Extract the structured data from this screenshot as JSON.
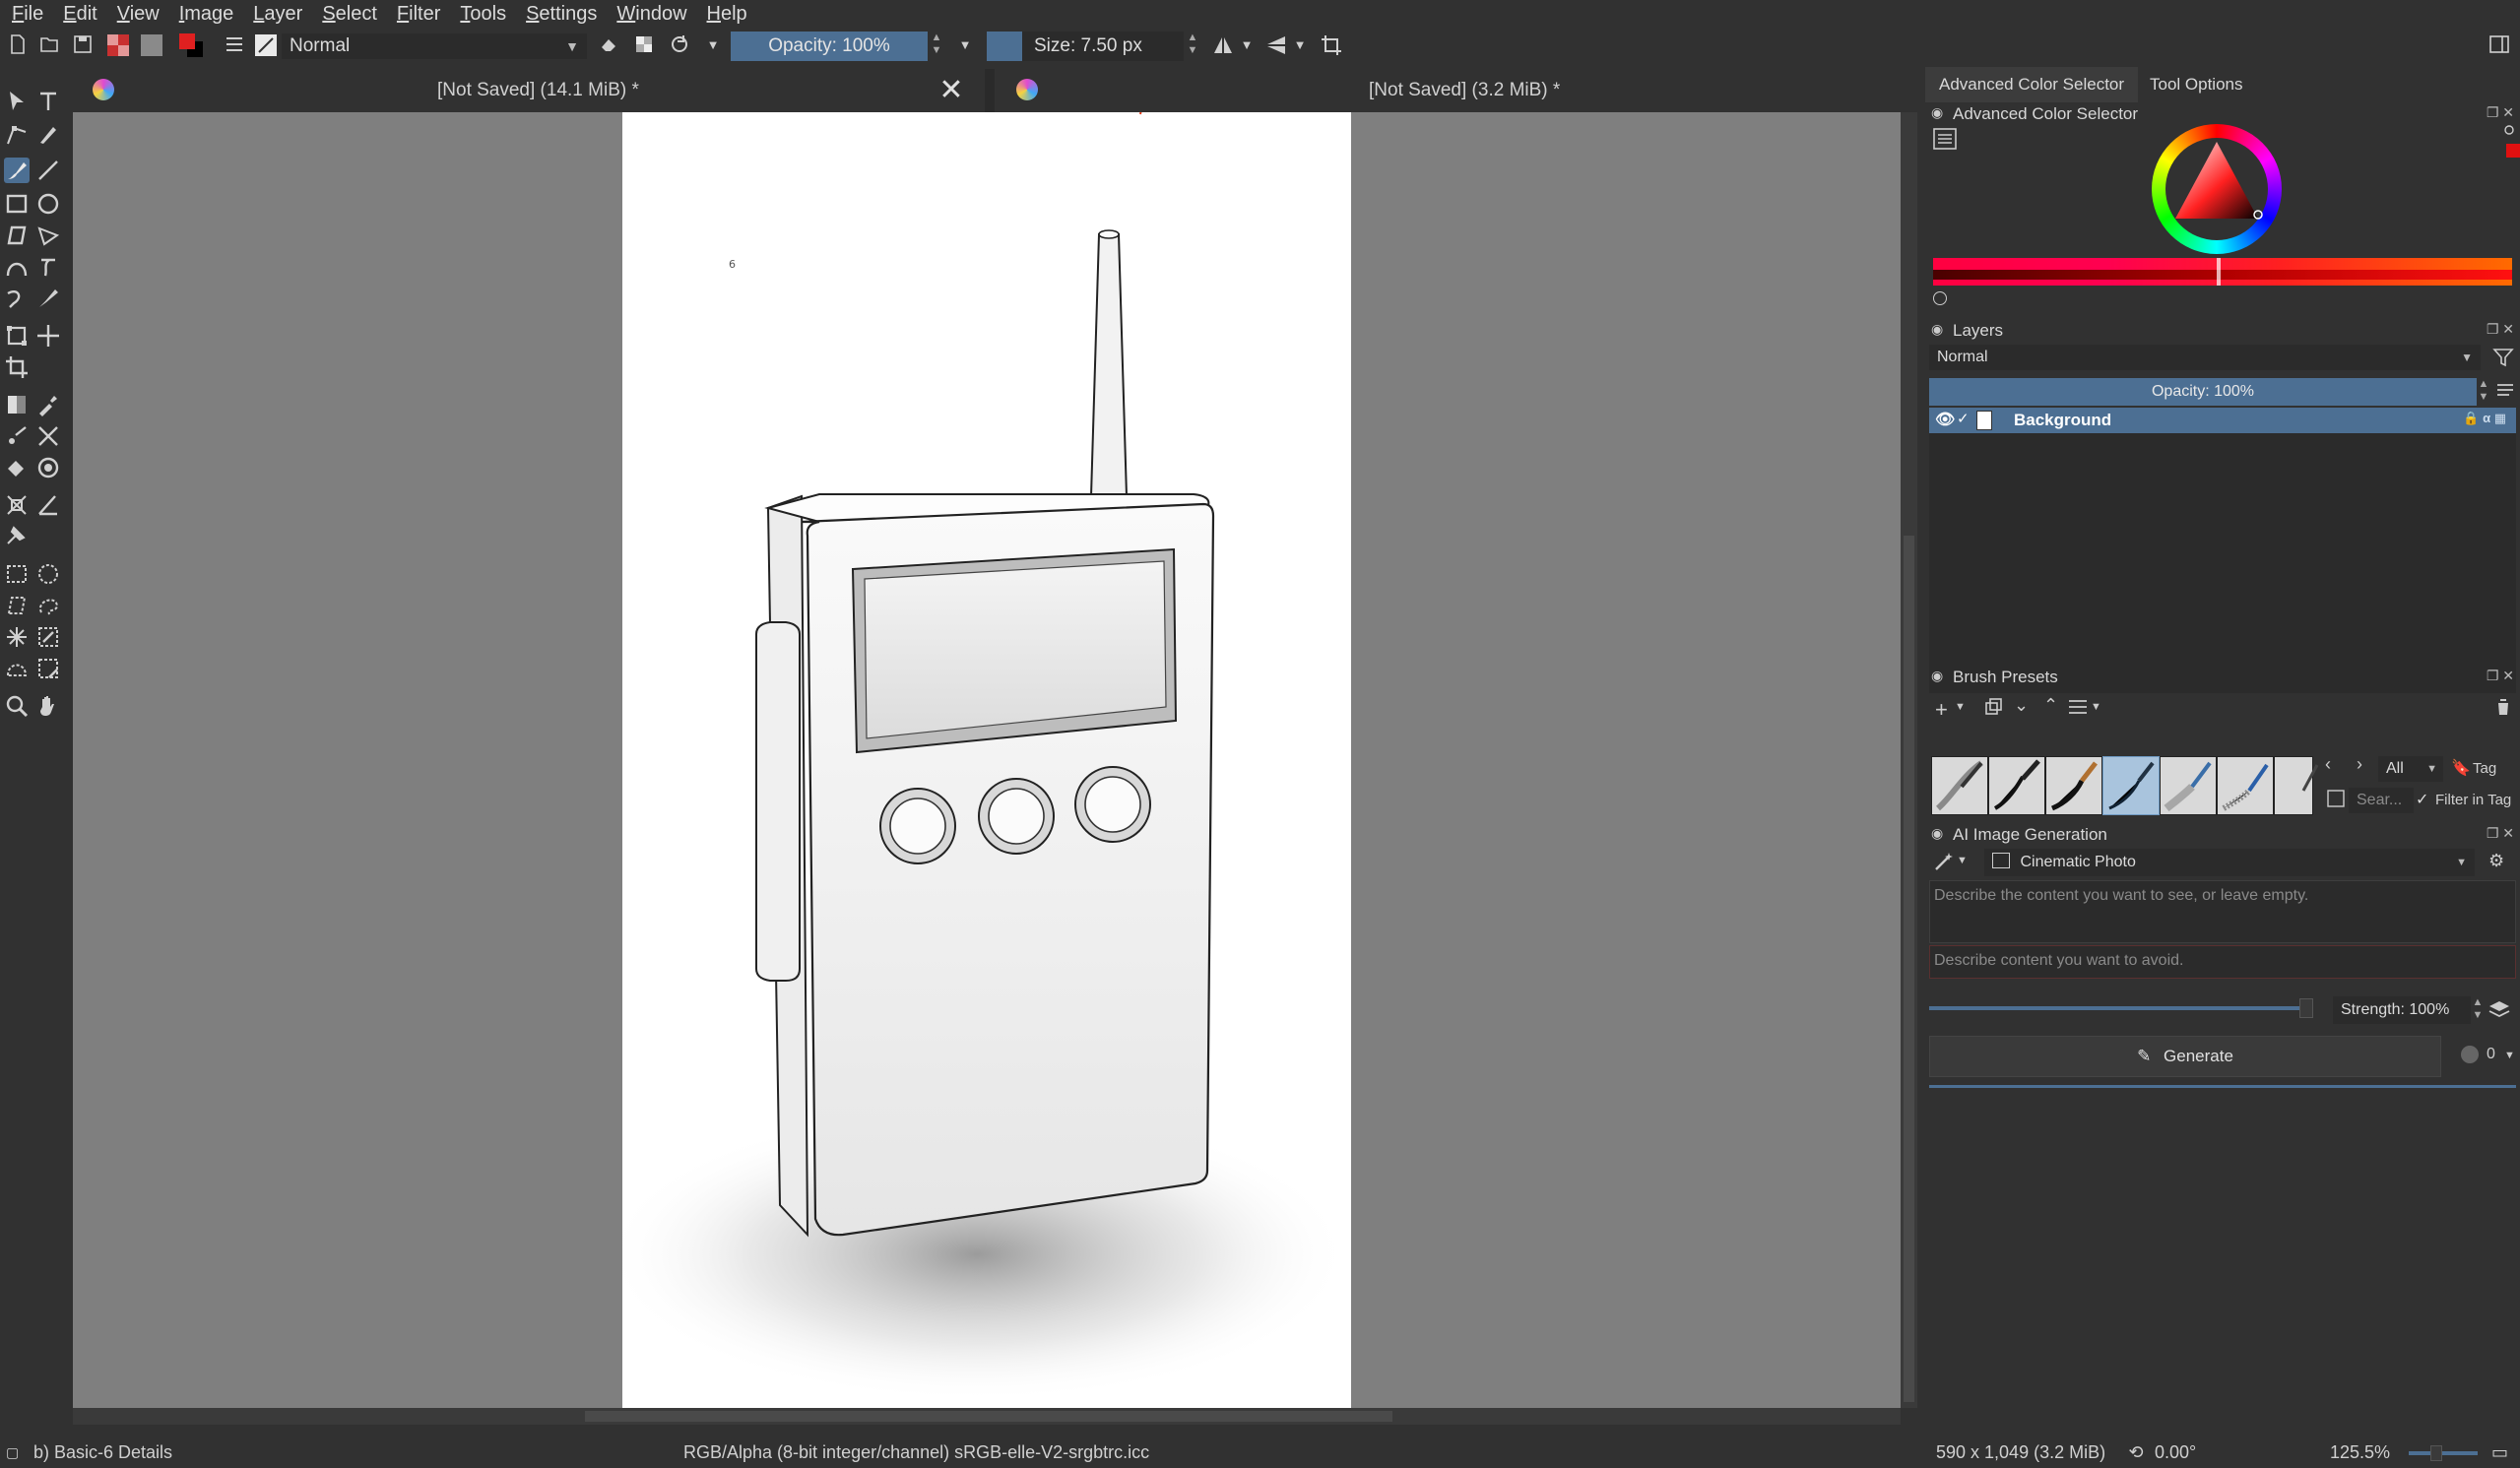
{
  "menu": [
    "File",
    "Edit",
    "View",
    "Image",
    "Layer",
    "Select",
    "Filter",
    "Tools",
    "Settings",
    "Window",
    "Help"
  ],
  "toolbar": {
    "blend_mode": "Normal",
    "opacity": "Opacity: 100%",
    "size": "Size: 7.50 px"
  },
  "tabs": [
    {
      "title": "[Not Saved]  (14.1 MiB) *",
      "close": "✕"
    },
    {
      "title": "[Not Saved]  (3.2 MiB) *",
      "close": "✕"
    }
  ],
  "docker": {
    "tabs": [
      "Advanced Color Selector",
      "Tool Options"
    ],
    "color_selector_title": "Advanced Color Selector",
    "layers": {
      "title": "Layers",
      "blend_mode": "Normal",
      "opacity": "Opacity:  100%",
      "items": [
        {
          "name": "Background"
        }
      ]
    },
    "brush_presets": {
      "title": "Brush Presets",
      "tag_filter": "All",
      "tag_label": "Tag",
      "search_placeholder": "Sear...",
      "filter_in_tag": "Filter in Tag"
    },
    "ai": {
      "title": "AI Image Generation",
      "style": "Cinematic Photo",
      "prompt_placeholder": "Describe the content you want to see, or leave empty.",
      "negative_placeholder": "Describe content you want to avoid.",
      "strength": "Strength: 100%",
      "generate": "Generate",
      "batch_count": "0"
    }
  },
  "status": {
    "brush": "b) Basic-6 Details",
    "color_space": "RGB/Alpha (8-bit integer/channel)  sRGB-elle-V2-srgbtrc.icc",
    "dimensions": "590 x 1,049 (3.2 MiB)",
    "rotation": "0.00°",
    "zoom": "125.5%"
  },
  "colors": {
    "accent": "#4c6f93",
    "background": "#313131",
    "canvas_bg": "#7f7f7f"
  }
}
